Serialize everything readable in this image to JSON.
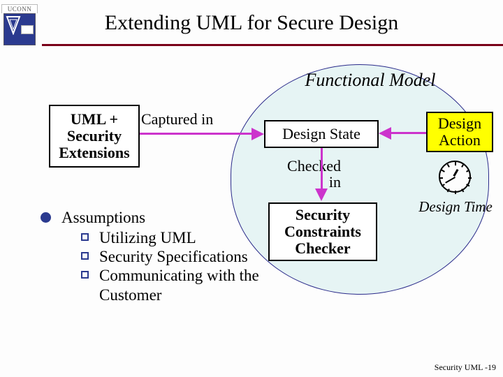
{
  "slide": {
    "title": "Extending UML for Secure Design",
    "footer": "Security UML -19",
    "logo_text": "UCONN"
  },
  "model": {
    "heading": "Functional Model",
    "uml_box": "UML + Security Extensions",
    "captured": "Captured in",
    "state_box": "Design State",
    "action_box": "Design Action",
    "checked": "Checked in",
    "checker_box": "Security Constraints Checker",
    "design_time": "Design Time"
  },
  "assumptions": {
    "heading": "Assumptions",
    "items": [
      "Utilizing UML",
      "Security Specifications",
      "Communicating with the Customer"
    ]
  }
}
